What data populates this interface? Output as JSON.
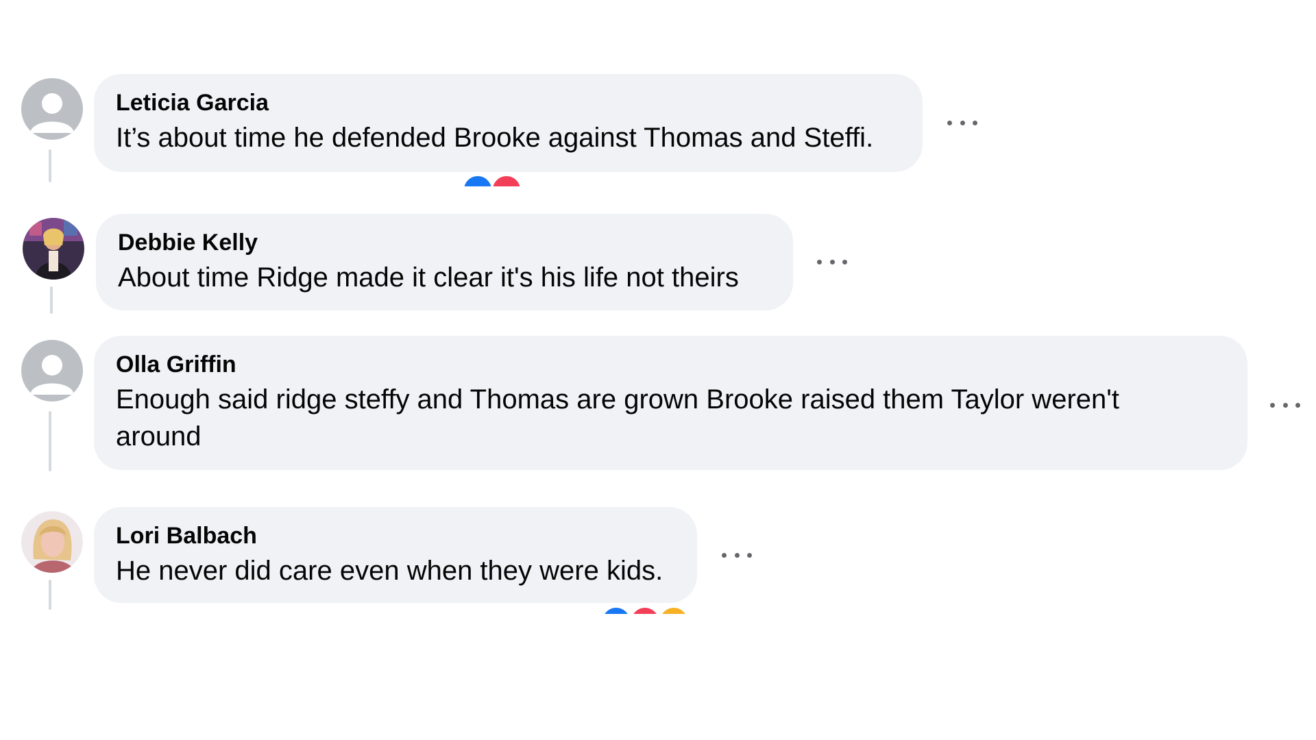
{
  "comments": [
    {
      "author": "Leticia Garcia",
      "text": "It’s about time he defended Brooke against Thomas and Steffi.",
      "avatar": "default-profile-icon",
      "reactions": [
        "like-icon",
        "love-icon"
      ]
    },
    {
      "author": "Debbie Kelly",
      "text": "About time Ridge made it clear it's his life not theirs",
      "avatar": "profile-photo"
    },
    {
      "author": "Olla Griffin",
      "text": "Enough said ridge steffy and Thomas are grown Brooke raised them Taylor weren't around",
      "avatar": "default-profile-icon"
    },
    {
      "author": "Lori Balbach",
      "text": "He never did care even when they were kids.",
      "avatar": "profile-photo",
      "reactions": [
        "like-icon",
        "love-icon",
        "haha-icon"
      ]
    }
  ],
  "colors": {
    "bubble": "#f0f2f5",
    "text": "#050505",
    "more": "#65676b",
    "thread_line": "#d6d9de",
    "like": "#1877f2",
    "love": "#f33e58",
    "haha": "#f7b125"
  }
}
